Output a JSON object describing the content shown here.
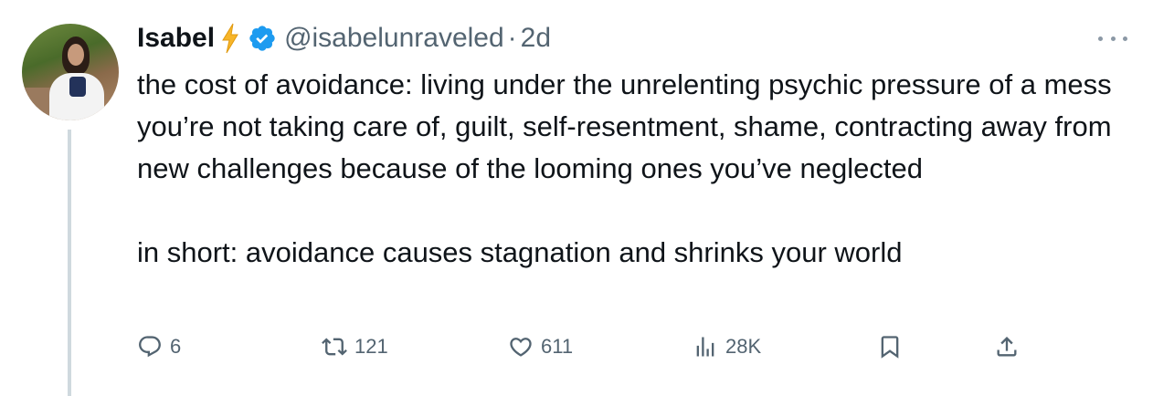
{
  "author": {
    "name": "Isabel",
    "name_emoji": "lightning-bolt",
    "verified": true,
    "handle": "@isabelunraveled",
    "separator": "·",
    "time": "2d"
  },
  "tweet": {
    "paragraph1": "the cost of avoidance: living under the unrelenting psychic pressure of a mess you’re not taking care of, guilt, self-resentment, shame, contracting away from new challenges because of the looming ones you’ve neglected",
    "paragraph2": "in short: avoidance causes stagnation and shrinks your world"
  },
  "actions": {
    "replies": "6",
    "reposts": "121",
    "likes": "611",
    "views": "28K"
  },
  "colors": {
    "text": "#0f1419",
    "secondary": "#536471",
    "verified": "#1d9bf0",
    "bolt": "#f7b529",
    "thread_line": "#cfd9de"
  }
}
